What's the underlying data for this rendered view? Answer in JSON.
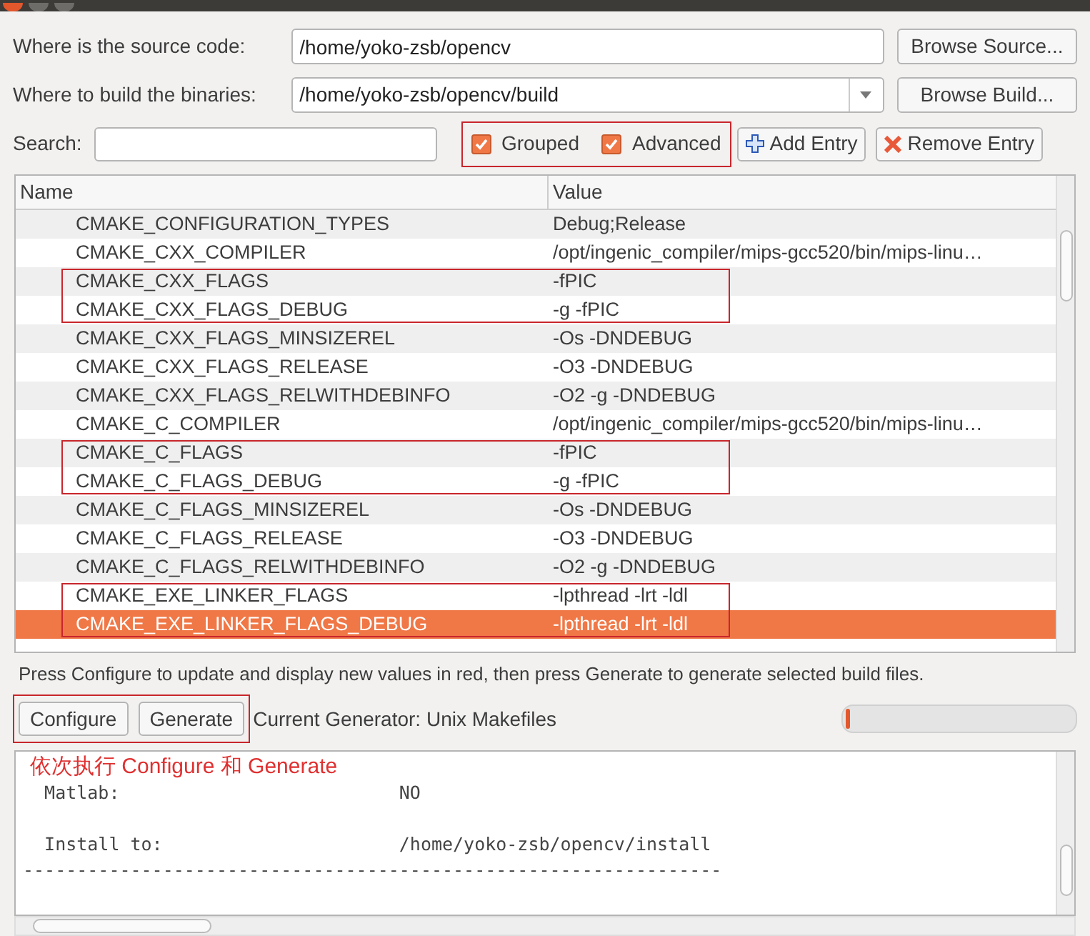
{
  "source": {
    "label": "Where is the source code:",
    "value": "/home/yoko-zsb/opencv",
    "button": "Browse Source..."
  },
  "build": {
    "label": "Where to build the binaries:",
    "value": "/home/yoko-zsb/opencv/build",
    "button": "Browse Build..."
  },
  "search": {
    "label": "Search:"
  },
  "toggles": {
    "annotated": true,
    "items": [
      {
        "label": "Grouped",
        "checked": true
      },
      {
        "label": "Advanced",
        "checked": true
      }
    ]
  },
  "add_entry": "Add Entry",
  "remove_entry": "Remove Entry",
  "table": {
    "columns": [
      "Name",
      "Value"
    ],
    "rows": [
      {
        "name": "CMAKE_CONFIGURATION_TYPES",
        "value": "Debug;Release",
        "selected": false,
        "annotated": false
      },
      {
        "name": "CMAKE_CXX_COMPILER",
        "value": "/opt/ingenic_compiler/mips-gcc520/bin/mips-linu…",
        "selected": false,
        "annotated": false
      },
      {
        "name": "CMAKE_CXX_FLAGS",
        "value": "-fPIC",
        "selected": false,
        "annotated": true
      },
      {
        "name": "CMAKE_CXX_FLAGS_DEBUG",
        "value": "-g -fPIC",
        "selected": false,
        "annotated": true
      },
      {
        "name": "CMAKE_CXX_FLAGS_MINSIZEREL",
        "value": "-Os -DNDEBUG",
        "selected": false,
        "annotated": false
      },
      {
        "name": "CMAKE_CXX_FLAGS_RELEASE",
        "value": "-O3 -DNDEBUG",
        "selected": false,
        "annotated": false
      },
      {
        "name": "CMAKE_CXX_FLAGS_RELWITHDEBINFO",
        "value": "-O2 -g -DNDEBUG",
        "selected": false,
        "annotated": false
      },
      {
        "name": "CMAKE_C_COMPILER",
        "value": "/opt/ingenic_compiler/mips-gcc520/bin/mips-linu…",
        "selected": false,
        "annotated": false
      },
      {
        "name": "CMAKE_C_FLAGS",
        "value": "-fPIC",
        "selected": false,
        "annotated": true
      },
      {
        "name": "CMAKE_C_FLAGS_DEBUG",
        "value": "-g -fPIC",
        "selected": false,
        "annotated": true
      },
      {
        "name": "CMAKE_C_FLAGS_MINSIZEREL",
        "value": "-Os -DNDEBUG",
        "selected": false,
        "annotated": false
      },
      {
        "name": "CMAKE_C_FLAGS_RELEASE",
        "value": "-O3 -DNDEBUG",
        "selected": false,
        "annotated": false
      },
      {
        "name": "CMAKE_C_FLAGS_RELWITHDEBINFO",
        "value": "-O2 -g -DNDEBUG",
        "selected": false,
        "annotated": false
      },
      {
        "name": "CMAKE_EXE_LINKER_FLAGS",
        "value": "-lpthread -lrt -ldl",
        "selected": false,
        "annotated": true
      },
      {
        "name": "CMAKE_EXE_LINKER_FLAGS_DEBUG",
        "value": "-lpthread -lrt -ldl",
        "selected": true,
        "annotated": true
      }
    ]
  },
  "message": "Press Configure to update and display new values in red, then press Generate to generate selected build files.",
  "actions": {
    "annotated": true,
    "buttons": [
      "Configure",
      "Generate"
    ]
  },
  "generator": "Current Generator: Unix Makefiles",
  "progress": {
    "level": 0.02
  },
  "annotation_note": "依次执行 Configure 和 Generate",
  "output": [
    [
      "  Matlab:                          NO"
    ],
    [
      "  Install to:                      /home/yoko-zsb/opencv/install",
      "-----------------------------------------------------------------"
    ]
  ]
}
